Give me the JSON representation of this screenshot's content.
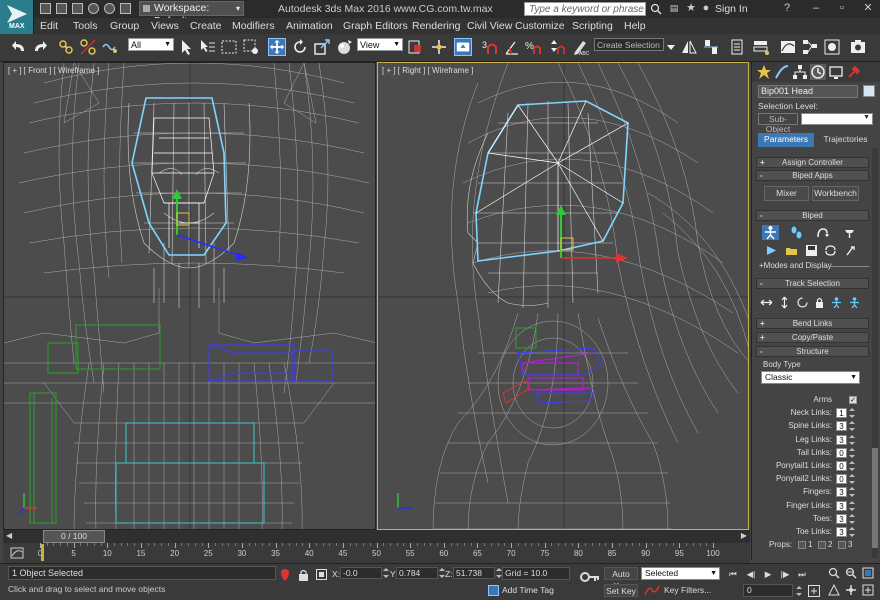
{
  "app": {
    "logo_text": "MAX",
    "title": "Autodesk 3ds Max 2016      www.CG.com.tw.max",
    "workspace_label": "Workspace: Default",
    "search_placeholder": "Type a keyword or phrase",
    "signin_label": "Sign In"
  },
  "menu": [
    "Edit",
    "Tools",
    "Group",
    "Views",
    "Create",
    "Modifiers",
    "Animation",
    "Graph Editors",
    "Rendering",
    "Civil View",
    "Customize",
    "Scripting",
    "Help"
  ],
  "toolbar": {
    "filter_value": "All",
    "refcoord_value": "View",
    "selection_set_placeholder": "Create Selection Se"
  },
  "viewports": {
    "front_label": "[ + ] [ Front ] [ Wireframe ]",
    "right_label": "[ + ] [ Right ] [ Wireframe ]"
  },
  "command_panel": {
    "object_name": "Bip001 Head",
    "selection_level_label": "Selection Level:",
    "subobject_label": "Sub-Object",
    "tab_parameters": "Parameters",
    "tab_trajectories": "Trajectories",
    "rollouts": {
      "assign_controller": "Assign Controller",
      "biped_apps": "Biped Apps",
      "biped": "Biped",
      "track_selection": "Track Selection",
      "bend_links": "Bend Links",
      "copy_paste": "Copy/Paste",
      "structure": "Structure"
    },
    "mixer_label": "Mixer",
    "workbench_label": "Workbench",
    "modes_display_label": "Modes and Display",
    "body_type_label": "Body Type",
    "body_type_value": "Classic",
    "structure_rows": [
      {
        "label": "Arms",
        "type": "check",
        "value": "✓"
      },
      {
        "label": "Neck Links:",
        "type": "spin",
        "value": "1"
      },
      {
        "label": "Spine Links:",
        "type": "spin",
        "value": "3"
      },
      {
        "label": "Leg Links:",
        "type": "spin",
        "value": "3"
      },
      {
        "label": "Tail Links:",
        "type": "spin",
        "value": "0"
      },
      {
        "label": "Ponytail1 Links:",
        "type": "spin",
        "value": "0"
      },
      {
        "label": "Ponytail2 Links:",
        "type": "spin",
        "value": "0"
      },
      {
        "label": "Fingers:",
        "type": "spin",
        "value": "3"
      },
      {
        "label": "Finger Links:",
        "type": "spin",
        "value": "3"
      },
      {
        "label": "Toes:",
        "type": "spin",
        "value": "3"
      },
      {
        "label": "Toe Links:",
        "type": "spin",
        "value": "3"
      }
    ],
    "props_label": "Props:",
    "props_values": [
      "1",
      "2",
      "3"
    ]
  },
  "timeline": {
    "slider_label": "0 / 100",
    "ticks": [
      "0",
      "5",
      "10",
      "15",
      "20",
      "25",
      "30",
      "35",
      "40",
      "45",
      "50",
      "55",
      "60",
      "65",
      "70",
      "75",
      "80",
      "85",
      "90",
      "95",
      "100"
    ]
  },
  "status": {
    "selection": "1 Object Selected",
    "prompt": "Click and drag to select and move objects",
    "x_label": "X:",
    "x_value": "-0.0",
    "y_label": "Y:",
    "y_value": "0.784",
    "z_label": "Z:",
    "z_value": "51.738",
    "grid": "Grid = 10.0",
    "add_time_tag": "Add Time Tag",
    "auto_key": "Auto Key",
    "set_key": "Set Key",
    "key_mode_value": "Selected",
    "key_filters": "Key Filters...",
    "frame_value": "0"
  },
  "colors": {
    "accent": "#3b78b5",
    "active_viewport_border": "#c8b14a",
    "selected_head_wire": "#7fd6ff",
    "wire_gray": "#bdbdbd"
  }
}
